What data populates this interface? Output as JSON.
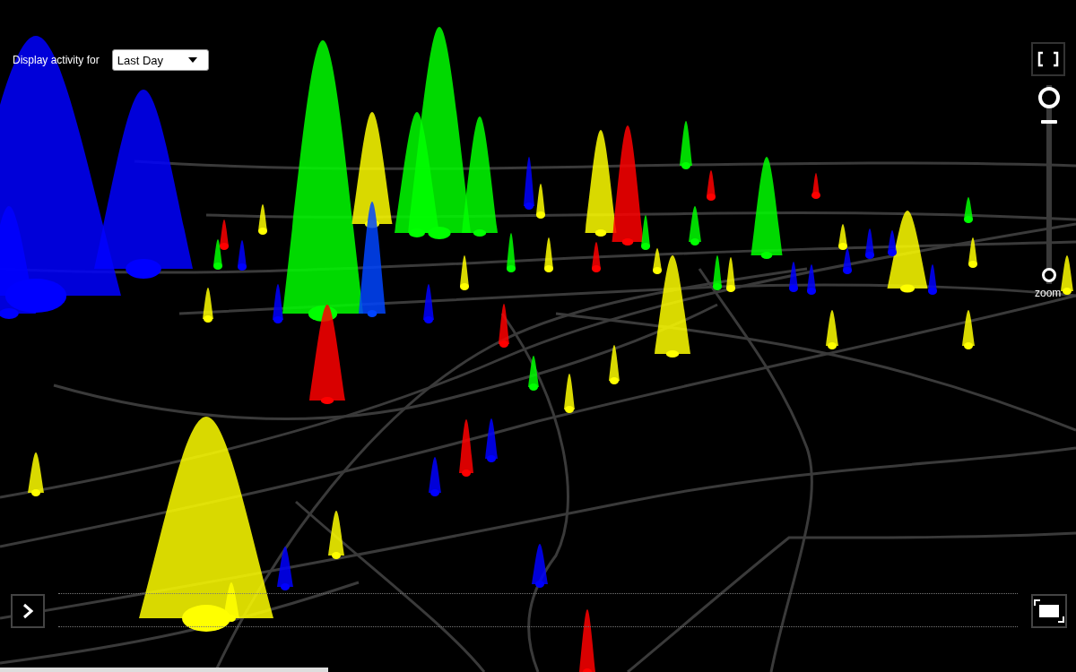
{
  "activity_filter": {
    "label": "Display activity for",
    "value": "Last Day"
  },
  "zoom": {
    "label": "zoom",
    "level": 0.8
  }
}
